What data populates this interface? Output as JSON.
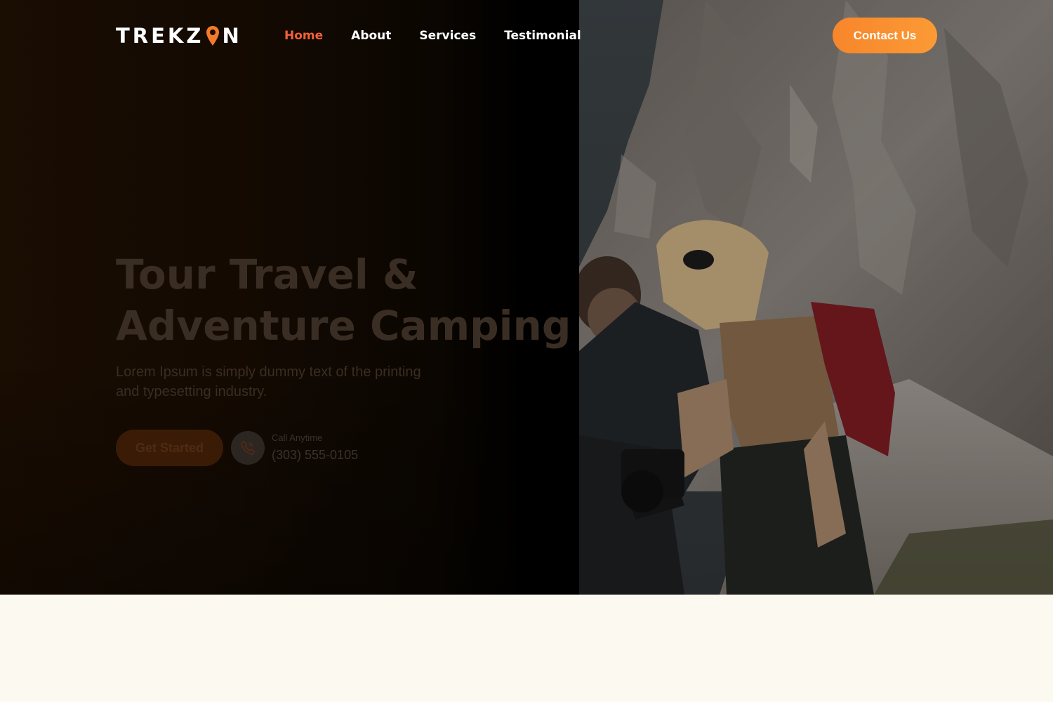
{
  "brand": {
    "logo_text_left": "TREKZ",
    "logo_text_right": "N"
  },
  "nav": {
    "items": [
      {
        "label": "Home",
        "active": true
      },
      {
        "label": "About",
        "active": false
      },
      {
        "label": "Services",
        "active": false
      },
      {
        "label": "Testimonial",
        "active": false
      }
    ],
    "contact_label": "Contact Us"
  },
  "hero": {
    "title_line1": "Tour Travel &",
    "title_line2": "Adventure Camping",
    "subtitle": "Lorem Ipsum is simply dummy text of the printing and typesetting industry.",
    "cta_label": "Get Started",
    "call_label": "Call Anytime",
    "call_number": "(303) 555-0105",
    "image_alt": "Two hikers laughing in front of a rocky mountain cliff"
  },
  "colors": {
    "accent": "#f2603a",
    "button_orange": "#f7862b",
    "page_background": "#fcfaf0"
  }
}
